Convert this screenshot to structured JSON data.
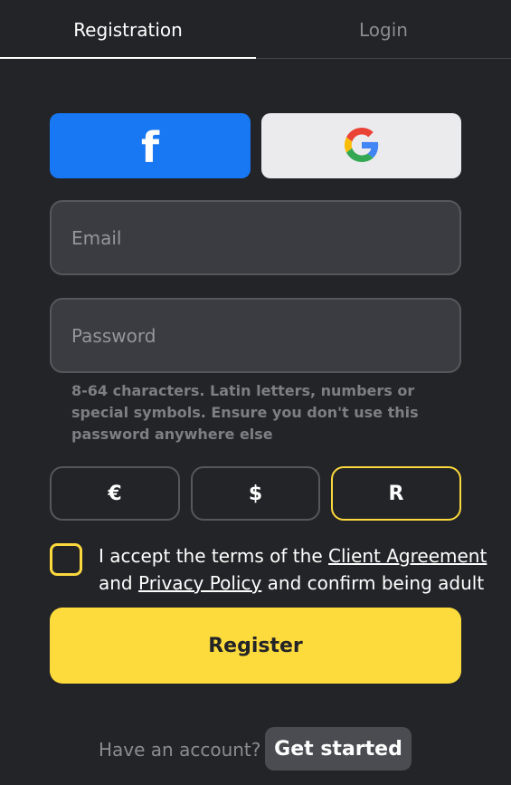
{
  "tabs": {
    "registration": "Registration",
    "login": "Login"
  },
  "social": {
    "facebook_icon": "facebook-icon",
    "facebook_glyph": "f",
    "google_icon": "google-icon"
  },
  "form": {
    "email_placeholder": "Email",
    "email_value": "",
    "password_placeholder": "Password",
    "password_value": "",
    "password_hint": "8-64 characters. Latin letters, numbers or special symbols. Ensure you don't use this password anywhere else"
  },
  "currencies": [
    {
      "label": "€",
      "selected": false
    },
    {
      "label": "$",
      "selected": false
    },
    {
      "label": "R",
      "selected": true
    }
  ],
  "terms": {
    "checked": false,
    "text_1": "I accept the terms of the ",
    "link_agreement": "Client Agreement",
    "text_2": "and ",
    "link_privacy": "Privacy Policy",
    "text_3": " and confirm being adult"
  },
  "register_label": "Register",
  "footer": {
    "have_account": "Have an account?",
    "get_started": "Get started"
  },
  "colors": {
    "background": "#232427",
    "accent_yellow": "#fedb3d",
    "facebook_blue": "#1877f2",
    "input_bg": "#3b3c41"
  }
}
